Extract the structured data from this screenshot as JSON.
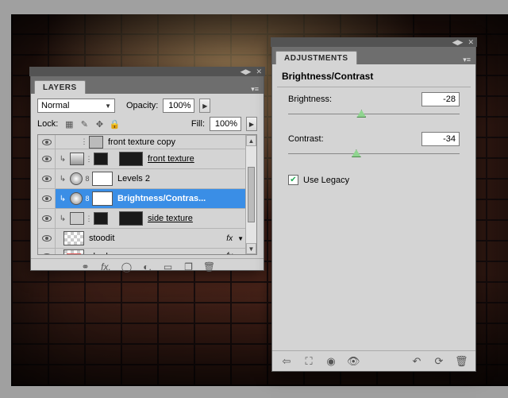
{
  "layers_panel": {
    "tab": "LAYERS",
    "blend_mode": "Normal",
    "opacity_label": "Opacity:",
    "opacity_value": "100%",
    "lock_label": "Lock:",
    "fill_label": "Fill:",
    "fill_value": "100%",
    "layers": [
      {
        "name": "front texture copy",
        "underline": false
      },
      {
        "name": "front texture",
        "underline": true
      },
      {
        "name": "Levels 2",
        "underline": false
      },
      {
        "name": "Brightness/Contras...",
        "underline": false,
        "selected": true
      },
      {
        "name": "side texture",
        "underline": true
      },
      {
        "name": "stoodit",
        "underline": false,
        "fx": "fx"
      },
      {
        "name": "shadow",
        "underline": false,
        "fx": "fx"
      }
    ]
  },
  "adjustments_panel": {
    "tab": "ADJUSTMENTS",
    "title": "Brightness/Contrast",
    "brightness_label": "Brightness:",
    "brightness_value": "-28",
    "contrast_label": "Contrast:",
    "contrast_value": "-34",
    "use_legacy_label": "Use Legacy",
    "use_legacy_checked": true
  }
}
